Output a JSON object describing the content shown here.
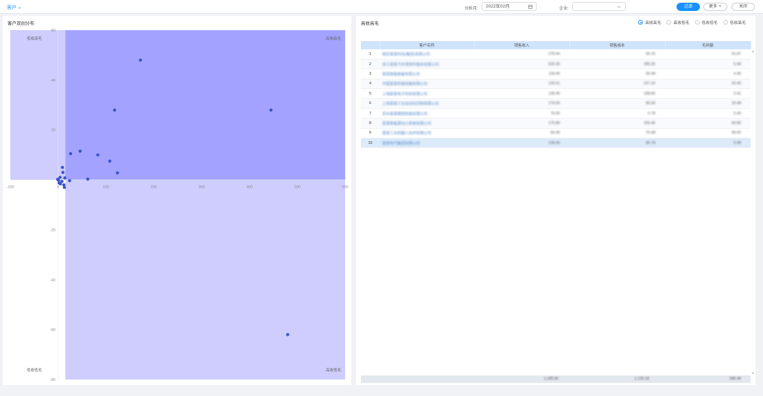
{
  "topbar": {
    "nav_label": "客户",
    "month_label": "分析月:",
    "month_value": "2022年02月",
    "company_label": "企业:",
    "company_value": "",
    "filter_button": "过滤",
    "more_button": "更多",
    "close_button": "关闭"
  },
  "chart_panel": {
    "title": "客户双创分布",
    "quadrants": {
      "top_left": "低收高毛",
      "top_right": "高收高毛",
      "bottom_left": "低收低毛",
      "bottom_right": "高收低毛"
    }
  },
  "chart_data": {
    "type": "scatter",
    "title": "",
    "xlabel": "",
    "ylabel": "",
    "xlim": [
      -100,
      600
    ],
    "ylim": [
      -80,
      60
    ],
    "x_ticks": [
      -100,
      0,
      100,
      200,
      300,
      400,
      500,
      600
    ],
    "y_ticks": [
      -80,
      -60,
      -40,
      -20,
      0,
      20,
      40,
      60
    ],
    "quadrant_split": {
      "x": 15,
      "y": 0
    },
    "colors": {
      "upper_right": "#a3a3ff",
      "other": "#cfcdfe",
      "point": "#3d52cc"
    },
    "points": [
      [
        172,
        48
      ],
      [
        118,
        28
      ],
      [
        445,
        28
      ],
      [
        46,
        11.5
      ],
      [
        26,
        10.5
      ],
      [
        83,
        10
      ],
      [
        108,
        7.5
      ],
      [
        124,
        2.8
      ],
      [
        9,
        5
      ],
      [
        10,
        3
      ],
      [
        62,
        0.3
      ],
      [
        24,
        -0.3
      ],
      [
        4,
        1
      ],
      [
        8,
        -0.6
      ],
      [
        14,
        0.8
      ],
      [
        2,
        -1.2
      ],
      [
        5,
        -1.6
      ],
      [
        12,
        -2
      ],
      [
        13,
        -3
      ],
      [
        -1,
        0.2
      ],
      [
        1,
        -0.2
      ],
      [
        480,
        -62
      ]
    ]
  },
  "table_panel": {
    "title": "高收高毛",
    "filters": [
      {
        "label": "高收高毛",
        "selected": true
      },
      {
        "label": "高收低毛",
        "selected": false
      },
      {
        "label": "低收低毛",
        "selected": false
      },
      {
        "label": "低收高毛",
        "selected": false
      }
    ],
    "columns": [
      "",
      "客户名称",
      "销售收入",
      "销售成本",
      "毛利额"
    ],
    "rows": [
      [
        "1",
        "南京某某科技(集团)有限公司",
        "278.44",
        "56.15",
        "91.87"
      ],
      [
        "2",
        "浙江某某汽车零部件股份有限公司",
        "526.35",
        "285.30",
        "5.48"
      ],
      [
        "3",
        "某某智能装备有限公司",
        "118.45",
        "55.48",
        "4.46"
      ],
      [
        "4",
        "中国某某机械设备有限公司",
        "126.51",
        "157.16",
        "26.45"
      ],
      [
        "5",
        "上海某某电子科技有限公司",
        "128.40",
        "168.80",
        "5.41"
      ],
      [
        "6",
        "上海某某工业自动化控制有限公司",
        "176.55",
        "85.56",
        "26.48"
      ],
      [
        "7",
        "苏州某某精密制造有限公司",
        "76.55",
        "5.78",
        "5.40"
      ],
      [
        "8",
        "某某新能源动力系统有限公司",
        "175.80",
        "166.46",
        "66.86"
      ],
      [
        "9",
        "某某工业机器人技术有限公司",
        "56.40",
        "75.48",
        "45.65"
      ],
      [
        "10",
        "某某电气集团有限公司",
        "128.45",
        "85.78",
        "5.48"
      ]
    ],
    "footer": {
      "revenue": "1,185.65",
      "cost": "1,125.18",
      "profit": "285.48"
    }
  }
}
